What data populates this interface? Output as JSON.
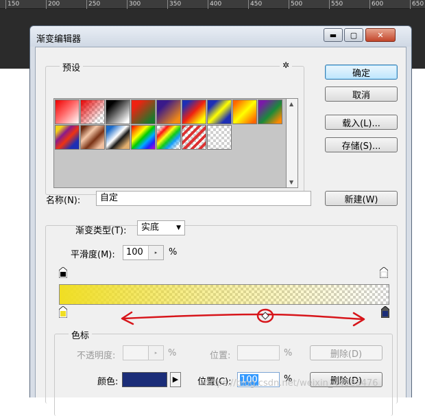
{
  "ruler": {
    "ticks": [
      "150",
      "200",
      "250",
      "300",
      "350",
      "400",
      "450",
      "500",
      "550",
      "600",
      "650"
    ]
  },
  "dialog": {
    "title": "渐变编辑器",
    "window_buttons": {
      "minimize": "▬",
      "maximize": "▢",
      "close": "✕"
    },
    "presets": {
      "title": "预设",
      "menu_icon": "gear-icon",
      "gear_glyph": "✲",
      "swatches": [
        "Red to transparent",
        "Red checker",
        "Black to white",
        "Red green",
        "Violet orange",
        "Blue red yellow",
        "Blue yellow blue",
        "Orange yellow orange",
        "Violet green orange",
        "Yellow violet orange blue",
        "Copper",
        "Chrome",
        "Spectrum",
        "Transparent rainbow",
        "Transparent stripes",
        "Transparent checker"
      ],
      "scroll": {
        "up": "▲",
        "down": "▼"
      }
    },
    "buttons": {
      "ok": "确定",
      "cancel": "取消",
      "load": "载入(L)...",
      "save": "存储(S)...",
      "new": "新建(W)"
    },
    "name": {
      "label": "名称(N):",
      "value": "自定"
    },
    "gradient_type": {
      "label": "渐变类型(T):",
      "value": "实底",
      "caret": "▼"
    },
    "smoothness": {
      "label": "平滑度(M):",
      "value": "100",
      "arrow": "▸",
      "unit": "%"
    },
    "gradient": {
      "start_color": "#f0de23",
      "end_opacity_percent": 0
    },
    "stops": {
      "title": "色标",
      "opacity_label": "不透明度:",
      "opacity_unit": "%",
      "opacity_location_label": "位置:",
      "opacity_location_unit": "%",
      "opacity_delete": "删除(D)",
      "color_label": "颜色:",
      "color_value": "#1b2d78",
      "color_arrow": "▶",
      "color_location_label": "位置(C):",
      "color_location_value": "100",
      "color_location_unit": "%",
      "color_delete": "删除(D)"
    },
    "watermark": "https://blog.csdn.net/weixin_44585476"
  }
}
